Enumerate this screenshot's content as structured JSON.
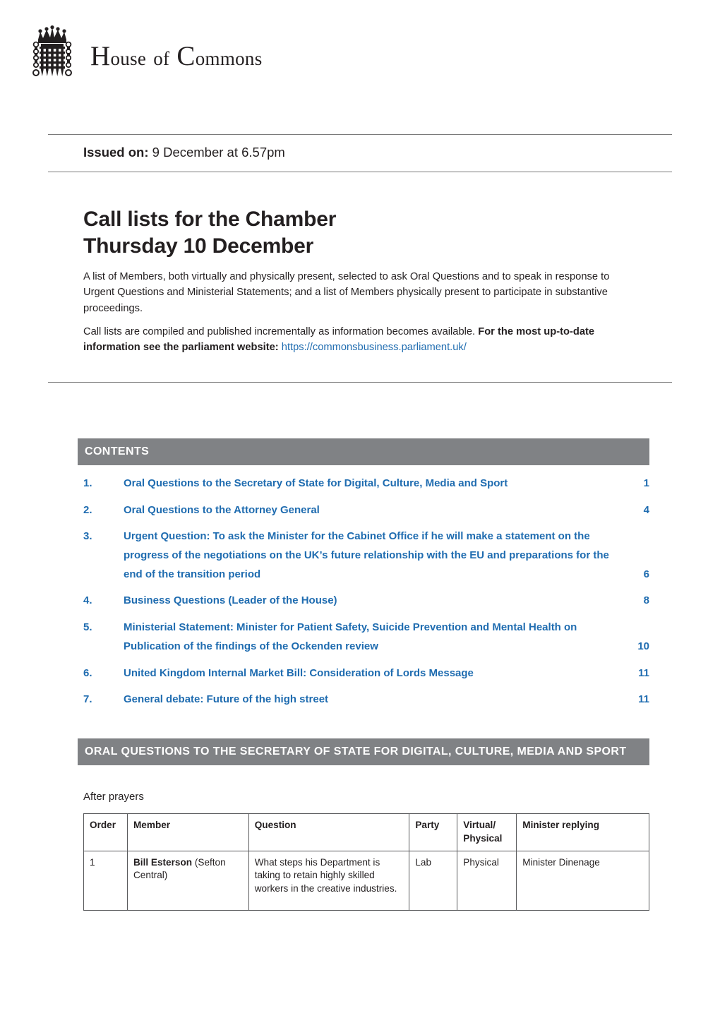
{
  "masthead": {
    "logo_icon": "portcullis-crown-icon",
    "title_part1": "H",
    "title_rest1": "ouse",
    "title_of": "of",
    "title_part2": "C",
    "title_rest2": "ommons",
    "full_title": "HOUSE OF COMMONS"
  },
  "header": {
    "issued_label": "Issued on:",
    "issued_value": "9 December at 6.57pm"
  },
  "title": {
    "line1": "Call lists for the Chamber",
    "line2": "Thursday 10 December"
  },
  "intro": {
    "paragraph1": "A list of Members, both virtually and physically present, selected to ask Oral Questions and to speak in response to Urgent Questions and Ministerial Statements; and a list of Members physically present to participate in substantive proceedings.",
    "paragraph2_plain": "Call lists are compiled and published incrementally as information becomes available. ",
    "paragraph2_bold": "For the most up-to-date information see the parliament website",
    "paragraph2_colon": ": ",
    "paragraph2_link": "https://commonsbusiness.parliament.uk/"
  },
  "contents": {
    "heading": "CONTENTS",
    "items": [
      {
        "number": "1.",
        "label": "Oral Questions to the Secretary of State for Digital, Culture, Media and Sport",
        "page": "1"
      },
      {
        "number": "2.",
        "label": "Oral Questions to the Attorney General",
        "page": "4"
      },
      {
        "number": "3.",
        "label": "Urgent Question: To ask the Minister for the Cabinet Office if he will make a statement on the progress of the negotiations on the UK’s future relationship with the EU and preparations for the end of the transition period",
        "page": "6"
      },
      {
        "number": "4.",
        "label": "Business Questions (Leader of the House)",
        "page": "8"
      },
      {
        "number": "5.",
        "label": "Ministerial Statement: Minister for Patient Safety, Suicide Prevention and Mental Health on Publication of the findings of the Ockenden review",
        "page": "10"
      },
      {
        "number": "6.",
        "label": "United Kingdom Internal Market Bill: Consideration of Lords Message",
        "page": "11"
      },
      {
        "number": "7.",
        "label": "General debate: Future of the high street",
        "page": "11"
      }
    ]
  },
  "section": {
    "heading": "ORAL QUESTIONS TO THE SECRETARY OF STATE FOR DIGITAL, CULTURE, MEDIA AND SPORT",
    "note": "After prayers"
  },
  "table": {
    "columns": [
      "Order",
      "Member",
      "Question",
      "Party",
      "Virtual/ Physical",
      "Minister replying"
    ],
    "col_vp_line1": "Virtual/",
    "col_vp_line2": "Physical",
    "rows": [
      {
        "order": "1",
        "member_name": "Bill Esterson",
        "member_constituency": " (Sefton Central)",
        "question": "What steps his Department is taking to retain highly skilled workers in the creative industries.",
        "party": "Lab",
        "virtual_physical": "Physical",
        "minister": "Minister Dinenage"
      }
    ]
  },
  "colors": {
    "accent_blue": "#1f6cb0",
    "bar_grey": "#808285",
    "text": "#231f20",
    "rule": "#7a7a7a"
  }
}
